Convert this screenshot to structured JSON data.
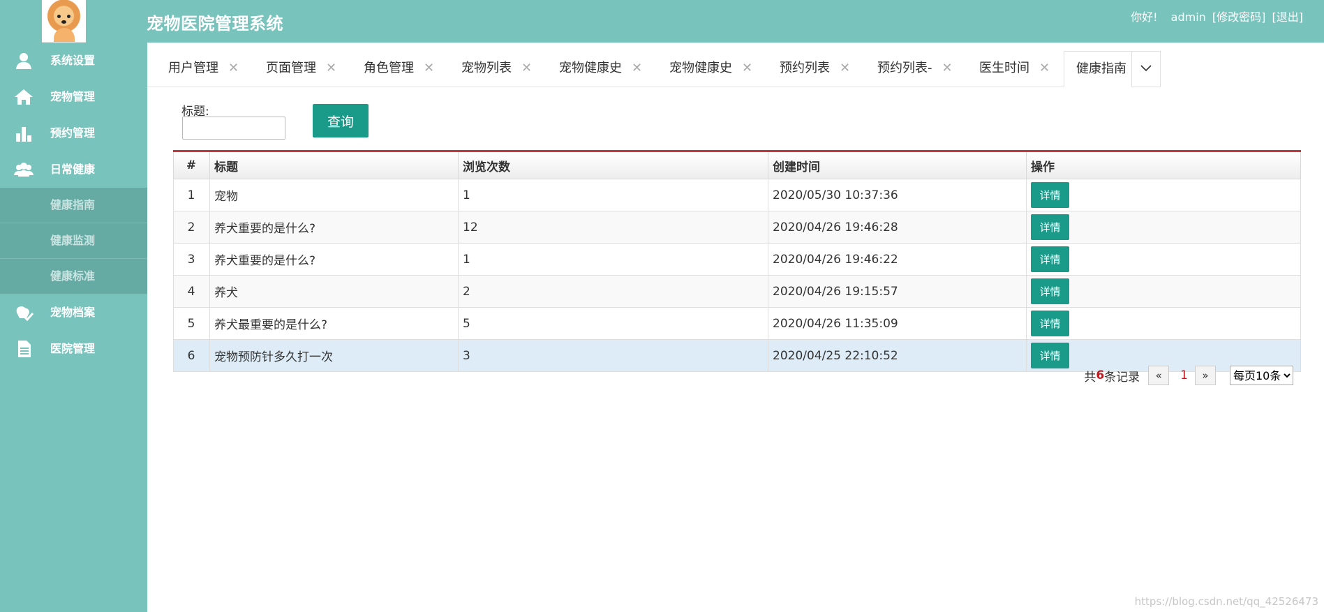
{
  "header": {
    "title": "宠物医院管理系统",
    "greeting": "你好!",
    "username": "admin",
    "change_password": "[修改密码]",
    "logout": "[退出]"
  },
  "sidebar": {
    "items": [
      {
        "label": "系统设置",
        "icon": "user-icon"
      },
      {
        "label": "宠物管理",
        "icon": "home-icon"
      },
      {
        "label": "预约管理",
        "icon": "bar-chart-icon"
      },
      {
        "label": "日常健康",
        "icon": "group-icon"
      }
    ],
    "subitems": [
      "健康指南",
      "健康监测",
      "健康标准"
    ],
    "items2": [
      {
        "label": "宠物档案",
        "icon": "pet-check-icon"
      },
      {
        "label": "医院管理",
        "icon": "document-icon"
      }
    ]
  },
  "tabs": [
    {
      "label": "用户管理"
    },
    {
      "label": "页面管理"
    },
    {
      "label": "角色管理"
    },
    {
      "label": "宠物列表"
    },
    {
      "label": "宠物健康史"
    },
    {
      "label": "宠物健康史"
    },
    {
      "label": "预约列表"
    },
    {
      "label": "预约列表-"
    },
    {
      "label": "医生时间"
    },
    {
      "label": "健康指南"
    }
  ],
  "tab_close_glyph": "✕",
  "filter": {
    "label": "标题:",
    "value": "",
    "query_label": "查询"
  },
  "table": {
    "headers": [
      "#",
      "标题",
      "浏览次数",
      "创建时间",
      "操作"
    ],
    "rows": [
      {
        "no": "1",
        "title": "宠物",
        "views": "1",
        "created": "2020/05/30 10:37:36",
        "action": "详情"
      },
      {
        "no": "2",
        "title": "养犬重要的是什么?",
        "views": "12",
        "created": "2020/04/26 19:46:28",
        "action": "详情"
      },
      {
        "no": "3",
        "title": "养犬重要的是什么?",
        "views": "1",
        "created": "2020/04/26 19:46:22",
        "action": "详情"
      },
      {
        "no": "4",
        "title": "养犬",
        "views": "2",
        "created": "2020/04/26 19:15:57",
        "action": "详情"
      },
      {
        "no": "5",
        "title": "养犬最重要的是什么?",
        "views": "5",
        "created": "2020/04/26 11:35:09",
        "action": "详情"
      },
      {
        "no": "6",
        "title": "宠物预防针多久打一次",
        "views": "3",
        "created": "2020/04/25 22:10:52",
        "action": "详情"
      }
    ]
  },
  "pager": {
    "prefix": "共",
    "total": "6",
    "suffix": "条记录",
    "prev": "«",
    "current": "1",
    "next": "»",
    "page_size": "每页10条"
  },
  "watermark": "https://blog.csdn.net/qq_42526473",
  "colors": {
    "header_bg": "#79c3bd",
    "accent": "#1a9b8a",
    "table_top_border": "#c0393b",
    "selected_row": "#ddecf6"
  }
}
